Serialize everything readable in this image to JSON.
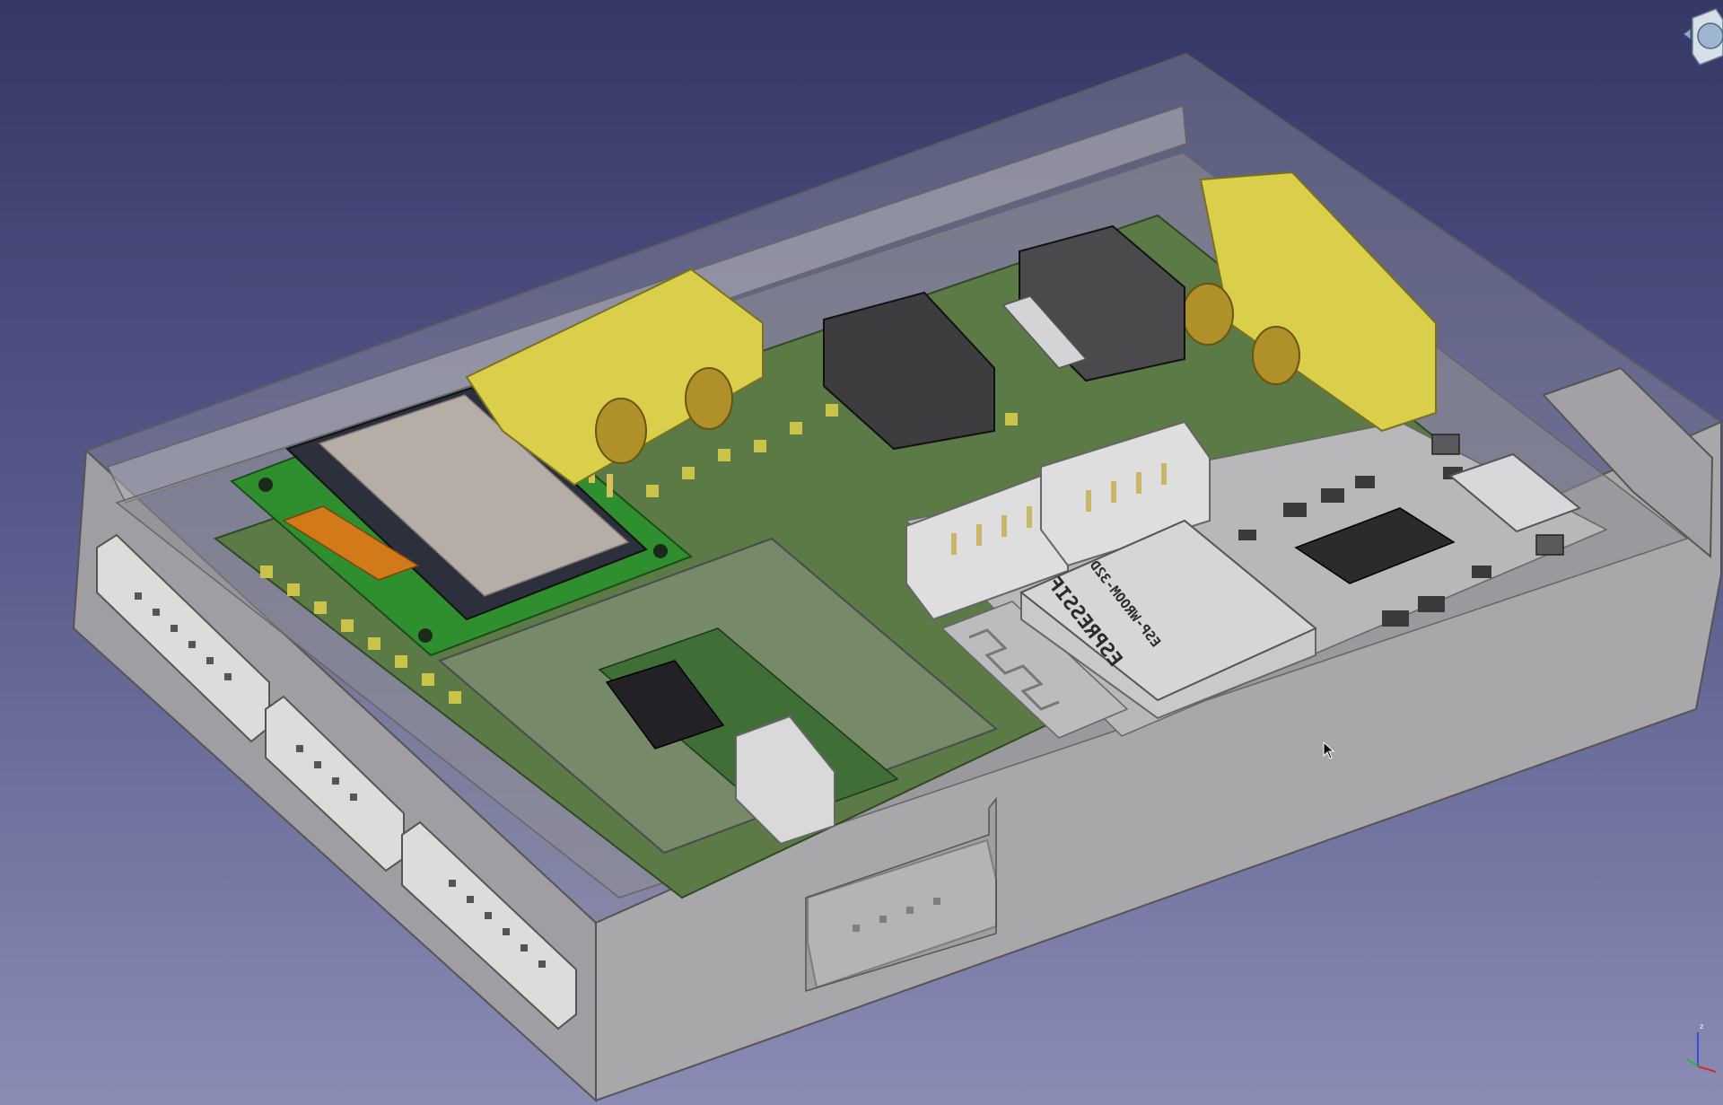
{
  "app": {
    "view": "3D viewport"
  },
  "colors": {
    "background_top": "#353866",
    "background_bottom": "#8a8cb4",
    "enclosure": "#a7a7a9",
    "pcb": "#5b7a45",
    "connector": "#d9cf4a",
    "header": "#d9d9d9"
  },
  "module": {
    "vendor_label": "ESPRESSIF",
    "model_label": "ESP-WROOM-32D"
  },
  "icons": {
    "navigation_cube": "navigation-cube-icon",
    "axis_cross": "axis-cross-icon",
    "mouse_cursor": "mouse-cursor-icon"
  },
  "axis": {
    "x": "",
    "y": "",
    "z": "z"
  }
}
